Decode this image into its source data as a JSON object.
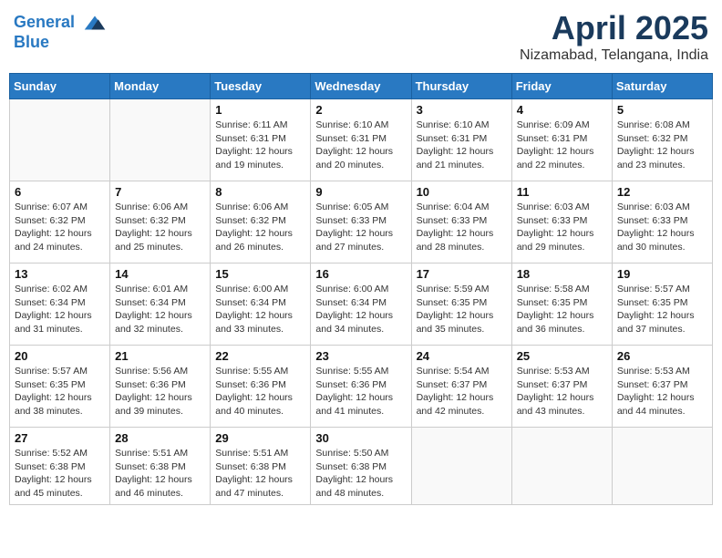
{
  "header": {
    "logo_line1": "General",
    "logo_line2": "Blue",
    "month_title": "April 2025",
    "location": "Nizamabad, Telangana, India"
  },
  "weekdays": [
    "Sunday",
    "Monday",
    "Tuesday",
    "Wednesday",
    "Thursday",
    "Friday",
    "Saturday"
  ],
  "weeks": [
    [
      {
        "day": "",
        "info": ""
      },
      {
        "day": "",
        "info": ""
      },
      {
        "day": "1",
        "info": "Sunrise: 6:11 AM\nSunset: 6:31 PM\nDaylight: 12 hours\nand 19 minutes."
      },
      {
        "day": "2",
        "info": "Sunrise: 6:10 AM\nSunset: 6:31 PM\nDaylight: 12 hours\nand 20 minutes."
      },
      {
        "day": "3",
        "info": "Sunrise: 6:10 AM\nSunset: 6:31 PM\nDaylight: 12 hours\nand 21 minutes."
      },
      {
        "day": "4",
        "info": "Sunrise: 6:09 AM\nSunset: 6:31 PM\nDaylight: 12 hours\nand 22 minutes."
      },
      {
        "day": "5",
        "info": "Sunrise: 6:08 AM\nSunset: 6:32 PM\nDaylight: 12 hours\nand 23 minutes."
      }
    ],
    [
      {
        "day": "6",
        "info": "Sunrise: 6:07 AM\nSunset: 6:32 PM\nDaylight: 12 hours\nand 24 minutes."
      },
      {
        "day": "7",
        "info": "Sunrise: 6:06 AM\nSunset: 6:32 PM\nDaylight: 12 hours\nand 25 minutes."
      },
      {
        "day": "8",
        "info": "Sunrise: 6:06 AM\nSunset: 6:32 PM\nDaylight: 12 hours\nand 26 minutes."
      },
      {
        "day": "9",
        "info": "Sunrise: 6:05 AM\nSunset: 6:33 PM\nDaylight: 12 hours\nand 27 minutes."
      },
      {
        "day": "10",
        "info": "Sunrise: 6:04 AM\nSunset: 6:33 PM\nDaylight: 12 hours\nand 28 minutes."
      },
      {
        "day": "11",
        "info": "Sunrise: 6:03 AM\nSunset: 6:33 PM\nDaylight: 12 hours\nand 29 minutes."
      },
      {
        "day": "12",
        "info": "Sunrise: 6:03 AM\nSunset: 6:33 PM\nDaylight: 12 hours\nand 30 minutes."
      }
    ],
    [
      {
        "day": "13",
        "info": "Sunrise: 6:02 AM\nSunset: 6:34 PM\nDaylight: 12 hours\nand 31 minutes."
      },
      {
        "day": "14",
        "info": "Sunrise: 6:01 AM\nSunset: 6:34 PM\nDaylight: 12 hours\nand 32 minutes."
      },
      {
        "day": "15",
        "info": "Sunrise: 6:00 AM\nSunset: 6:34 PM\nDaylight: 12 hours\nand 33 minutes."
      },
      {
        "day": "16",
        "info": "Sunrise: 6:00 AM\nSunset: 6:34 PM\nDaylight: 12 hours\nand 34 minutes."
      },
      {
        "day": "17",
        "info": "Sunrise: 5:59 AM\nSunset: 6:35 PM\nDaylight: 12 hours\nand 35 minutes."
      },
      {
        "day": "18",
        "info": "Sunrise: 5:58 AM\nSunset: 6:35 PM\nDaylight: 12 hours\nand 36 minutes."
      },
      {
        "day": "19",
        "info": "Sunrise: 5:57 AM\nSunset: 6:35 PM\nDaylight: 12 hours\nand 37 minutes."
      }
    ],
    [
      {
        "day": "20",
        "info": "Sunrise: 5:57 AM\nSunset: 6:35 PM\nDaylight: 12 hours\nand 38 minutes."
      },
      {
        "day": "21",
        "info": "Sunrise: 5:56 AM\nSunset: 6:36 PM\nDaylight: 12 hours\nand 39 minutes."
      },
      {
        "day": "22",
        "info": "Sunrise: 5:55 AM\nSunset: 6:36 PM\nDaylight: 12 hours\nand 40 minutes."
      },
      {
        "day": "23",
        "info": "Sunrise: 5:55 AM\nSunset: 6:36 PM\nDaylight: 12 hours\nand 41 minutes."
      },
      {
        "day": "24",
        "info": "Sunrise: 5:54 AM\nSunset: 6:37 PM\nDaylight: 12 hours\nand 42 minutes."
      },
      {
        "day": "25",
        "info": "Sunrise: 5:53 AM\nSunset: 6:37 PM\nDaylight: 12 hours\nand 43 minutes."
      },
      {
        "day": "26",
        "info": "Sunrise: 5:53 AM\nSunset: 6:37 PM\nDaylight: 12 hours\nand 44 minutes."
      }
    ],
    [
      {
        "day": "27",
        "info": "Sunrise: 5:52 AM\nSunset: 6:38 PM\nDaylight: 12 hours\nand 45 minutes."
      },
      {
        "day": "28",
        "info": "Sunrise: 5:51 AM\nSunset: 6:38 PM\nDaylight: 12 hours\nand 46 minutes."
      },
      {
        "day": "29",
        "info": "Sunrise: 5:51 AM\nSunset: 6:38 PM\nDaylight: 12 hours\nand 47 minutes."
      },
      {
        "day": "30",
        "info": "Sunrise: 5:50 AM\nSunset: 6:38 PM\nDaylight: 12 hours\nand 48 minutes."
      },
      {
        "day": "",
        "info": ""
      },
      {
        "day": "",
        "info": ""
      },
      {
        "day": "",
        "info": ""
      }
    ]
  ]
}
